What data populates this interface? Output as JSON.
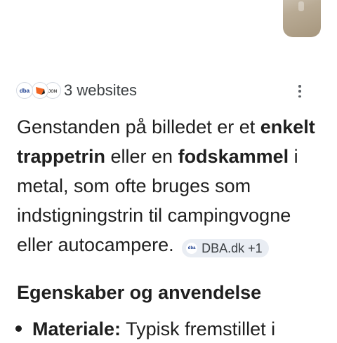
{
  "sources": {
    "favicon_dba": "dba",
    "favicon_third": "ᴊᴏɴ",
    "label": "3 websites"
  },
  "answer": {
    "part1": "Genstanden på billedet er et ",
    "bold1": "enkelt trappetrin",
    "part2": " eller en ",
    "bold2": "fodskammel",
    "part3": " i metal, som ofte bruges som indstigningstrin til campingvogne eller autocampere.",
    "chip_icon": "dba",
    "chip_label": "DBA.dk +1"
  },
  "section": {
    "heading": "Egenskaber og anvendelse",
    "bullet_bold": "Materiale:",
    "bullet_text": " Typisk fremstillet i"
  },
  "colors": {
    "text": "#1f1f1f",
    "chip_bg": "#e9edf3",
    "dba_blue": "#1b3d8f",
    "orange": "#f26522"
  }
}
